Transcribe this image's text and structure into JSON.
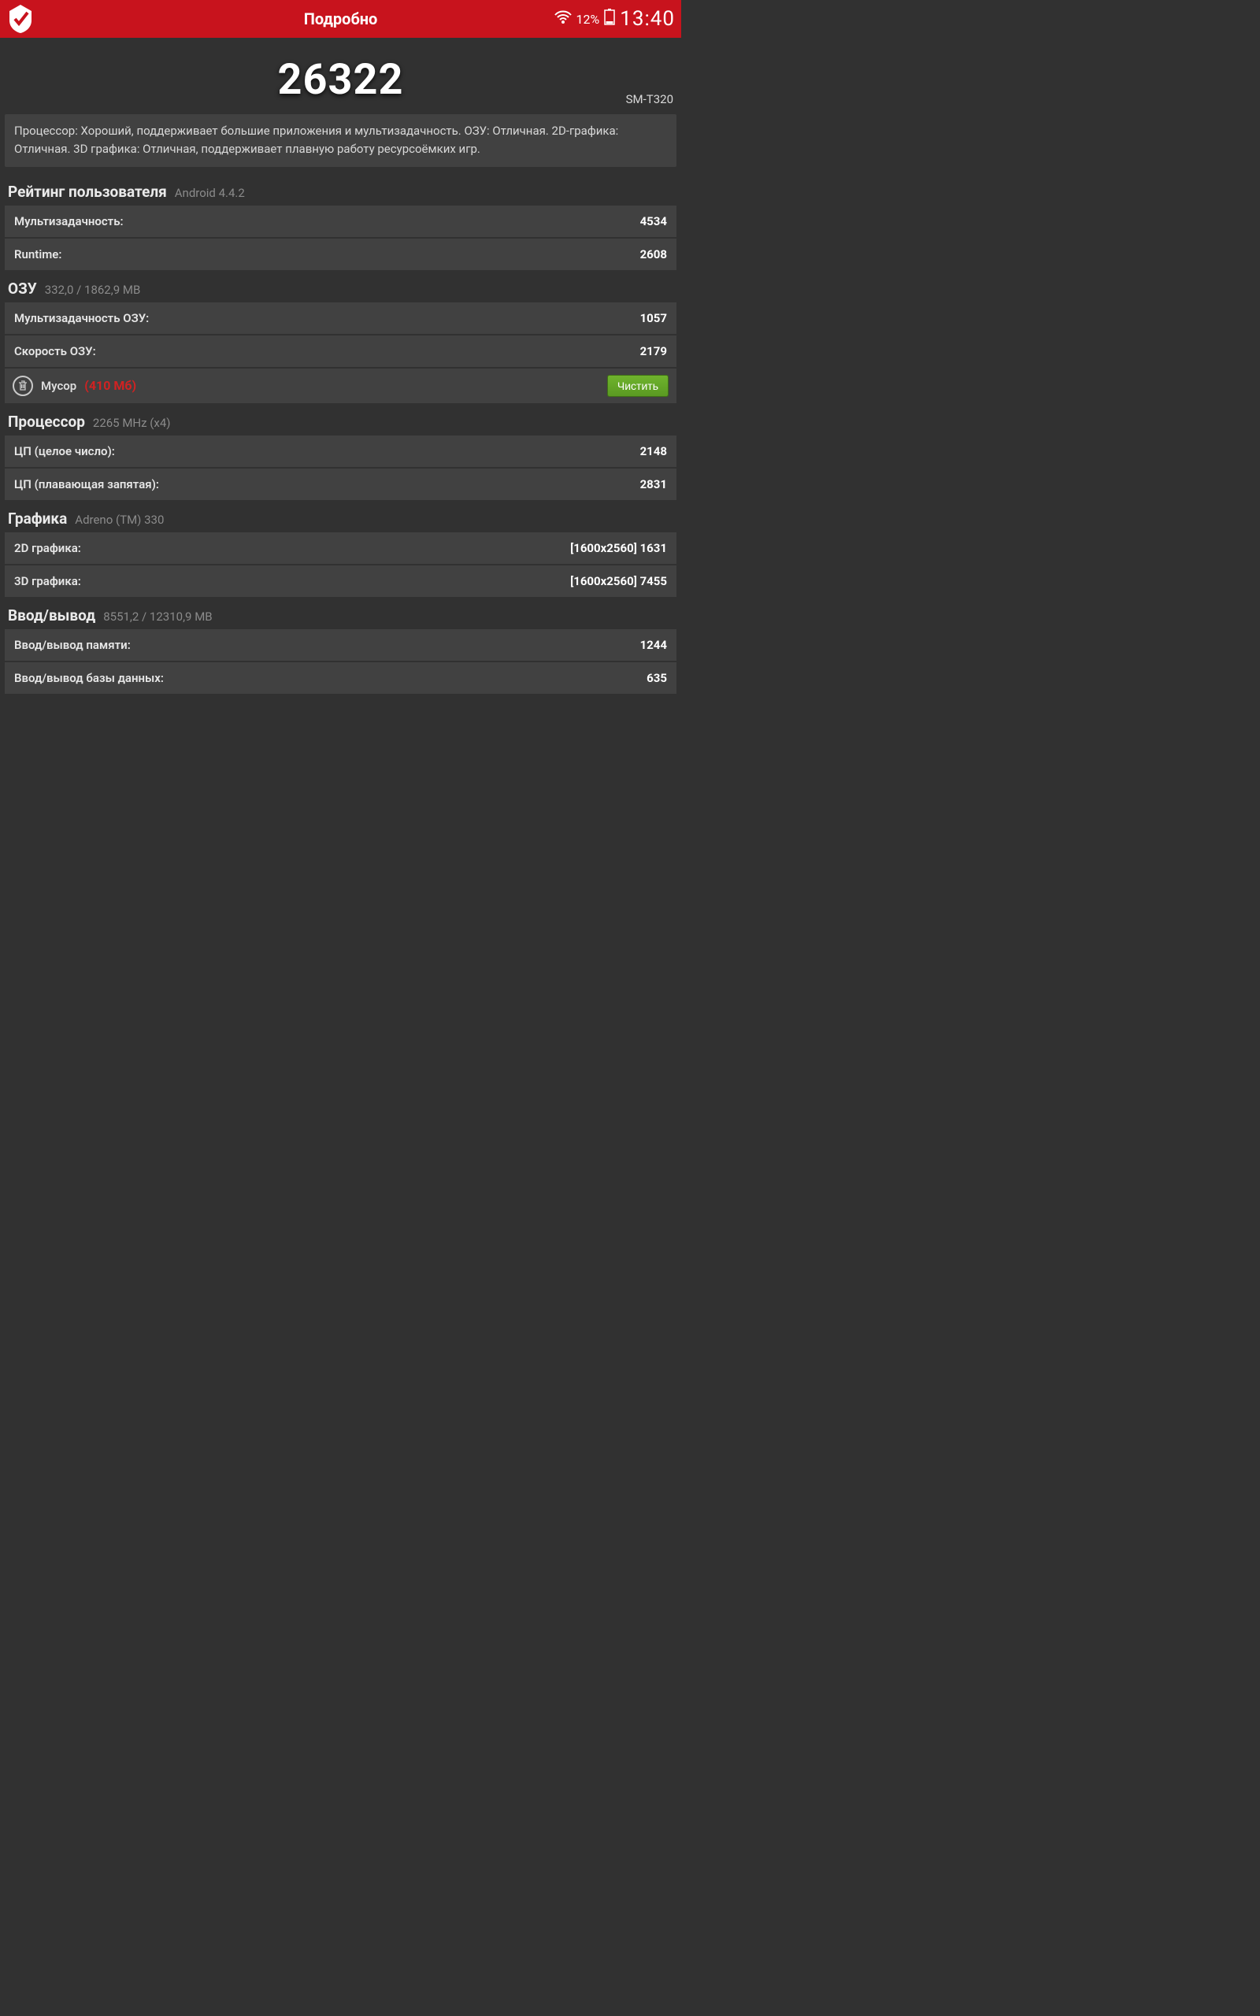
{
  "statusbar": {
    "title": "Подробно",
    "battery_pct": "12%",
    "clock": "13:40"
  },
  "score": "26322",
  "device_model": "SM-T320",
  "summary_text": "Процессор: Хороший, поддерживает большие приложения и мультизадачность. ОЗУ: Отличная. 2D-графика: Отличная. 3D графика: Отличная, поддерживает плавную работу ресурсоёмких игр.",
  "sections": {
    "user_rating": {
      "title": "Рейтинг пользователя",
      "sub": "Android 4.4.2",
      "rows": {
        "multitask": {
          "label": "Мультизадачность:",
          "value": "4534"
        },
        "runtime": {
          "label": "Runtime:",
          "value": "2608"
        }
      }
    },
    "ram": {
      "title": "ОЗУ",
      "sub": "332,0 / 1862,9 MB",
      "rows": {
        "ram_multitask": {
          "label": "Мультизадачность ОЗУ:",
          "value": "1057"
        },
        "ram_speed": {
          "label": "Скорость ОЗУ:",
          "value": "2179"
        }
      },
      "cleaner": {
        "label": "Мусор",
        "size": "(410 Мб)",
        "button": "Чистить"
      }
    },
    "cpu": {
      "title": "Процессор",
      "sub": "2265 MHz (x4)",
      "rows": {
        "cpu_int": {
          "label": "ЦП (целое число):",
          "value": "2148"
        },
        "cpu_float": {
          "label": "ЦП (плавающая запятая):",
          "value": "2831"
        }
      }
    },
    "gfx": {
      "title": "Графика",
      "sub": "Adreno (TM) 330",
      "rows": {
        "g2d": {
          "label": "2D графика:",
          "value": "[1600x2560] 1631"
        },
        "g3d": {
          "label": "3D графика:",
          "value": "[1600x2560] 7455"
        }
      }
    },
    "io": {
      "title": "Ввод/вывод",
      "sub": "8551,2 / 12310,9 MB",
      "rows": {
        "io_mem": {
          "label": "Ввод/вывод памяти:",
          "value": "1244"
        },
        "io_db": {
          "label": "Ввод/вывод базы данных:",
          "value": "635"
        }
      }
    }
  }
}
